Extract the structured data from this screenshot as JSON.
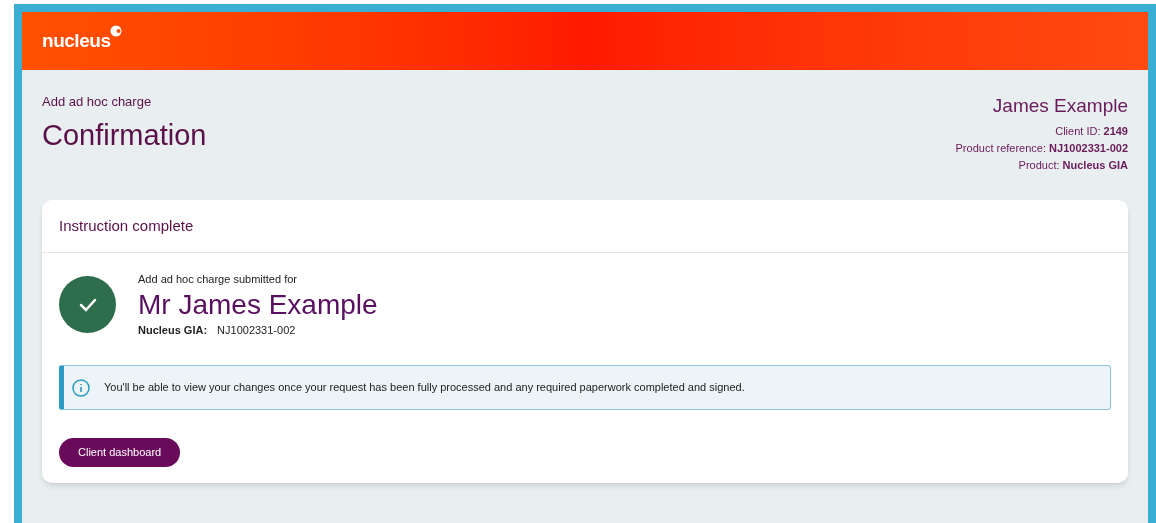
{
  "header": {
    "logo": "nucleus"
  },
  "page": {
    "breadcrumb": "Add ad hoc charge",
    "title": "Confirmation"
  },
  "client": {
    "name": "James Example",
    "details": [
      {
        "label": "Client ID:",
        "value": "2149"
      },
      {
        "label": "Product reference:",
        "value": "NJ1002331-002"
      },
      {
        "label": "Product:",
        "value": "Nucleus GIA"
      }
    ]
  },
  "card": {
    "title": "Instruction complete",
    "submitted_label": "Add ad hoc charge submitted for",
    "client_name": "Mr James Example",
    "product_label": "Nucleus GIA:",
    "product_ref": "NJ1002331-002",
    "info": "You'll be able to view your changes once your request has been fully processed and any required paperwork completed and signed.",
    "button": "Client dashboard"
  }
}
